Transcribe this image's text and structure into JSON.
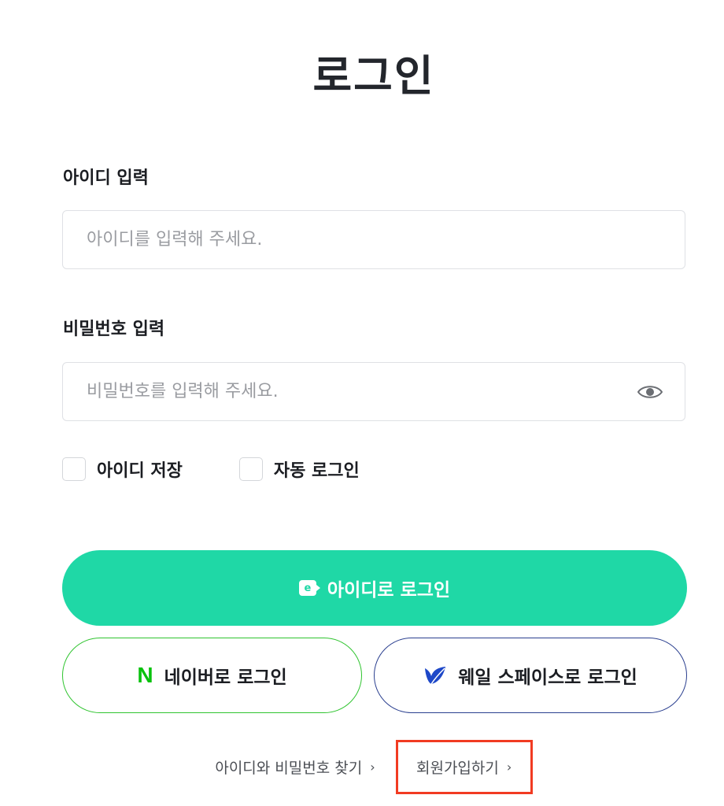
{
  "page": {
    "title": "로그인"
  },
  "id_field": {
    "label": "아이디 입력",
    "placeholder": "아이디를 입력해 주세요.",
    "value": ""
  },
  "password_field": {
    "label": "비밀번호 입력",
    "placeholder": "비밀번호를 입력해 주세요.",
    "value": "",
    "toggle_icon": "eye-icon"
  },
  "options": {
    "save_id_label": "아이디 저장",
    "save_id_checked": false,
    "auto_login_label": "자동 로그인",
    "auto_login_checked": false
  },
  "buttons": {
    "id_login_label": "아이디로 로그인",
    "id_login_icon": "e-icon",
    "naver_login_label": "네이버로 로그인",
    "naver_icon_text": "N",
    "whale_login_label": "웨일 스페이스로 로그인",
    "whale_icon": "whale-icon"
  },
  "footer": {
    "find_label": "아이디와 비밀번호 찾기",
    "signup_label": "회원가입하기",
    "chevron": "›"
  },
  "colors": {
    "primary": "#1fd8a6",
    "naver": "#08c20d",
    "whale": "#2a3f8f",
    "highlight": "#f13b22"
  }
}
